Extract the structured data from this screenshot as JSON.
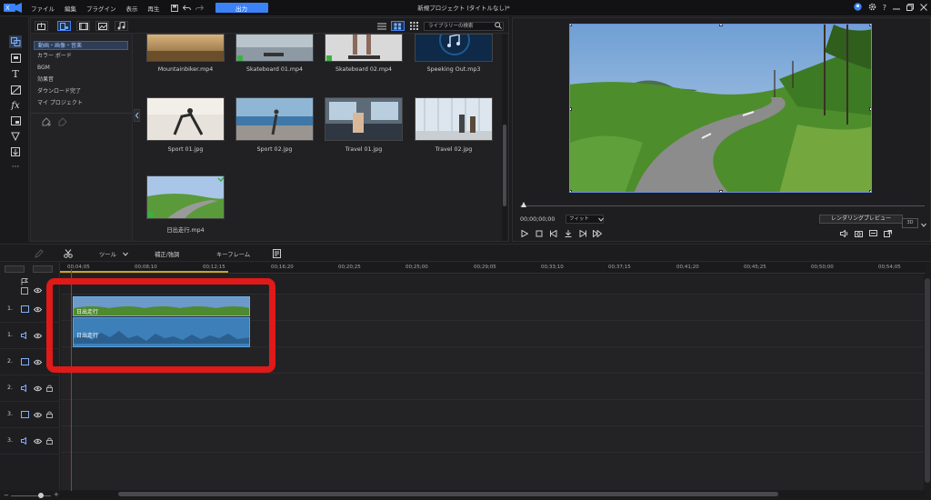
{
  "menu": {
    "items": [
      "ファイル",
      "編集",
      "プラグイン",
      "表示",
      "再生"
    ],
    "export_label": "出力"
  },
  "window": {
    "title": "新規プロジェクト (タイトルなし)*"
  },
  "library": {
    "search_placeholder": "ライブラリーの検索",
    "tree": [
      "動画・画像・音楽",
      "カラー ボード",
      "BGM",
      "効果音",
      "ダウンロード完了",
      "マイ プロジェクト"
    ],
    "media": [
      {
        "label": "Mountainbiker.mp4",
        "kind": "field"
      },
      {
        "label": "Skateboard 01.mp4",
        "kind": "skate"
      },
      {
        "label": "Skateboard 02.mp4",
        "kind": "skate2"
      },
      {
        "label": "Speeking Out.mp3",
        "kind": "audio"
      },
      {
        "label": "Sport 01.jpg",
        "kind": "sport"
      },
      {
        "label": "Sport 02.jpg",
        "kind": "sea"
      },
      {
        "label": "Travel 01.jpg",
        "kind": "train"
      },
      {
        "label": "Travel 02.jpg",
        "kind": "airport"
      },
      {
        "label": "日出走行.mp4",
        "kind": "road"
      }
    ]
  },
  "preview": {
    "timecode": "00;00;00;00",
    "fit": "フィット",
    "render_label": "レンダリングプレビュー"
  },
  "timeline": {
    "toolbar": {
      "tool": "ツール",
      "fix": "補正/強調",
      "keyframe": "キーフレーム"
    },
    "ruler": [
      "00;04;05",
      "00;08;10",
      "00;12;15",
      "00;16;20",
      "00;20;25",
      "00;25;00",
      "00;29;05",
      "00;33;10",
      "00;37;15",
      "00;41;20",
      "00;45;25",
      "00;50;00",
      "00;54;05"
    ],
    "tracks": [
      "1.",
      "1.",
      "2.",
      "2.",
      "3.",
      "3."
    ],
    "video_clip_label": "日出走行",
    "audio_clip_label": "日出走行"
  },
  "colors": {
    "accent": "#3b82f6",
    "highlight": "#e01919",
    "playhead": "#c62828",
    "clip": "#4a8fc7"
  }
}
